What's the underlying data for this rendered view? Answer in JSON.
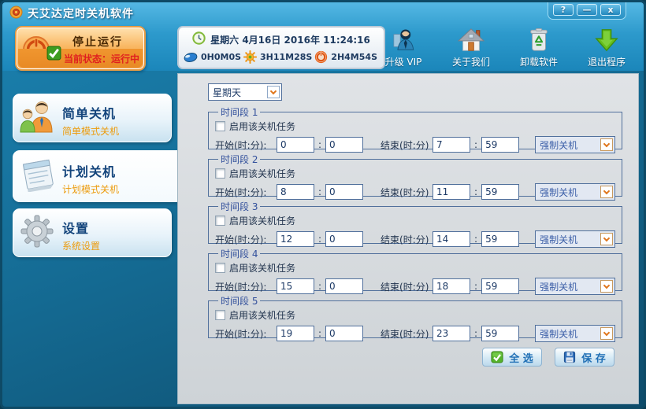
{
  "window": {
    "title": "天艾达定时关机软件",
    "controls": {
      "help": "?",
      "minimize": "—",
      "close": "x"
    }
  },
  "header": {
    "stop_button": {
      "label": "停止运行",
      "status": "当前状态：运行中"
    },
    "clock": {
      "datetime": "星期六 4月16日 2016年 11:24:16",
      "timers": [
        {
          "icon": "mouse-icon",
          "value": "0H0M0S"
        },
        {
          "icon": "sun-icon",
          "value": "3H11M28S"
        },
        {
          "icon": "power-icon",
          "value": "2H4M54S"
        }
      ]
    },
    "toolbar": [
      {
        "icon": "vip-person-icon",
        "label": "升级 VIP"
      },
      {
        "icon": "house-icon",
        "label": "关于我们"
      },
      {
        "icon": "trash-icon",
        "label": "卸载软件"
      },
      {
        "icon": "green-down-arrow-icon",
        "label": "退出程序"
      }
    ]
  },
  "sidebar": {
    "items": [
      {
        "title": "简单关机",
        "subtitle": "简单模式关机"
      },
      {
        "title": "计划关机",
        "subtitle": "计划模式关机"
      },
      {
        "title": "设置",
        "subtitle": "系统设置"
      }
    ]
  },
  "main": {
    "day_select": {
      "value": "星期天"
    },
    "labels": {
      "enable": "启用该关机任务",
      "start": "开始(时:分):",
      "end": "结束(时:分)",
      "colon": ":"
    },
    "periods": [
      {
        "legend": "时间段 1",
        "start_hour": "0",
        "start_min": "0",
        "end_hour": "7",
        "end_min": "59",
        "action": "强制关机"
      },
      {
        "legend": "时间段 2",
        "start_hour": "8",
        "start_min": "0",
        "end_hour": "11",
        "end_min": "59",
        "action": "强制关机"
      },
      {
        "legend": "时间段 3",
        "start_hour": "12",
        "start_min": "0",
        "end_hour": "14",
        "end_min": "59",
        "action": "强制关机"
      },
      {
        "legend": "时间段 4",
        "start_hour": "15",
        "start_min": "0",
        "end_hour": "18",
        "end_min": "59",
        "action": "强制关机"
      },
      {
        "legend": "时间段 5",
        "start_hour": "19",
        "start_min": "0",
        "end_hour": "23",
        "end_min": "59",
        "action": "强制关机"
      }
    ],
    "buttons": {
      "select_all": "全 选",
      "save": "保 存"
    }
  }
}
